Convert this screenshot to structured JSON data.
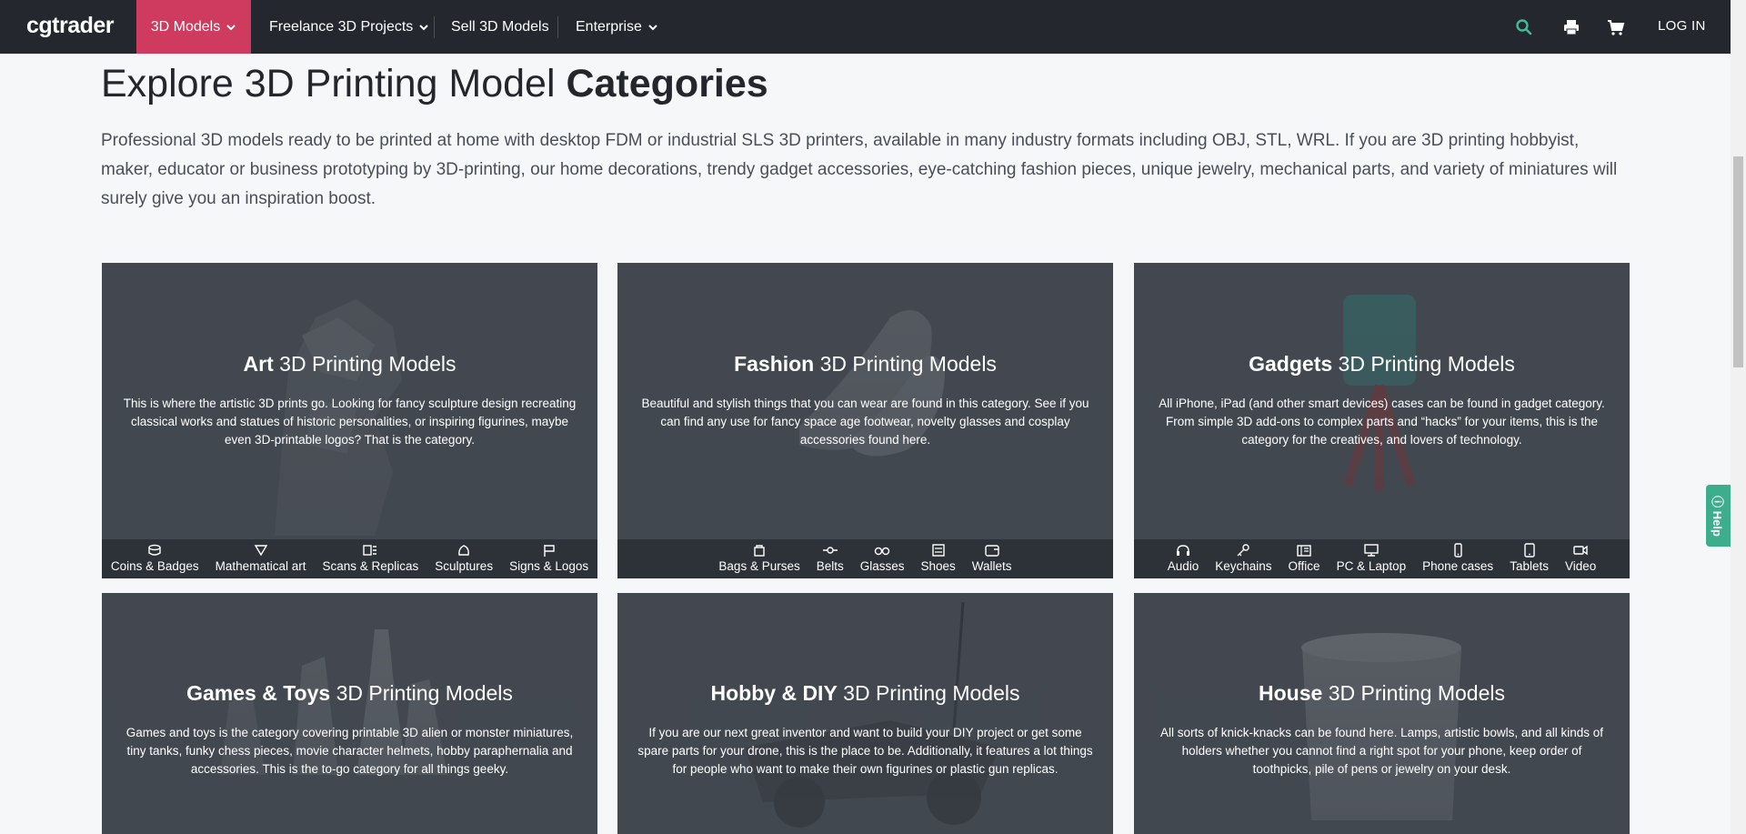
{
  "nav": {
    "logo": "cgtrader",
    "items": [
      {
        "label": "3D Models",
        "has_dropdown": true,
        "active": true
      },
      {
        "label": "Freelance 3D Projects",
        "has_dropdown": true,
        "active": false
      },
      {
        "label": "Sell 3D Models",
        "has_dropdown": false,
        "active": false
      },
      {
        "label": "Enterprise",
        "has_dropdown": true,
        "active": false
      }
    ],
    "icons": [
      "search-icon",
      "printer-icon",
      "cart-icon"
    ],
    "login_label": "LOG IN"
  },
  "page": {
    "title_regular": "Explore 3D Printing Model ",
    "title_bold": "Categories",
    "intro": "Professional 3D models ready to be printed at home with desktop FDM or industrial SLS 3D printers, available in many industry formats including OBJ, STL, WRL. If you are 3D printing hobbyist, maker, educator or business prototyping by 3D-printing, our home decorations, trendy gadget accessories, eye-catching fashion pieces, unique jewelry, mechanical parts, and variety of miniatures will surely give you an inspiration boost."
  },
  "title_suffix": "3D Printing Models",
  "categories": [
    {
      "name": "Art",
      "description": "This is where the artistic 3D prints go. Looking for fancy sculpture design recreating classical works and statues of historic personalities, or inspiring figurines, maybe even 3D-printable logos? That is the category.",
      "subcategories": [
        "Coins & Badges",
        "Mathematical art",
        "Scans & Replicas",
        "Sculptures",
        "Signs & Logos"
      ]
    },
    {
      "name": "Fashion",
      "description": "Beautiful and stylish things that you can wear are found in this category. See if you can find any use for fancy space age footwear, novelty glasses and cosplay accessories found here.",
      "subcategories": [
        "Bags & Purses",
        "Belts",
        "Glasses",
        "Shoes",
        "Wallets"
      ]
    },
    {
      "name": "Gadgets",
      "description": "All iPhone, iPad (and other smart devices) cases can be found in gadget category. From simple 3D add-ons to complex parts and “hacks” for your items, this is the category for the creatives, and lovers of technology.",
      "subcategories": [
        "Audio",
        "Keychains",
        "Office",
        "PC & Laptop",
        "Phone cases",
        "Tablets",
        "Video"
      ]
    },
    {
      "name": "Games & Toys",
      "description": "Games and toys is the category covering printable 3D alien or monster miniatures, tiny tanks, funky chess pieces, movie character helmets, hobby paraphernalia and accessories. This is the to-go category for all things geeky.",
      "subcategories": []
    },
    {
      "name": "Hobby & DIY",
      "description": "If you are our next great inventor and want to build your DIY project or get some spare parts for your drone, this is the place to be. Additionally, it features a lot things for people who want to make their own figurines or plastic gun replicas.",
      "subcategories": []
    },
    {
      "name": "House",
      "description": "All sorts of knick-knacks can be found here. Lamps, artistic bowls, and all kinds of holders whether you cannot find a right spot for your phone, keep order of toothpicks, pile of pens or jewelry on your desk.",
      "subcategories": []
    }
  ],
  "help_label": "Help"
}
